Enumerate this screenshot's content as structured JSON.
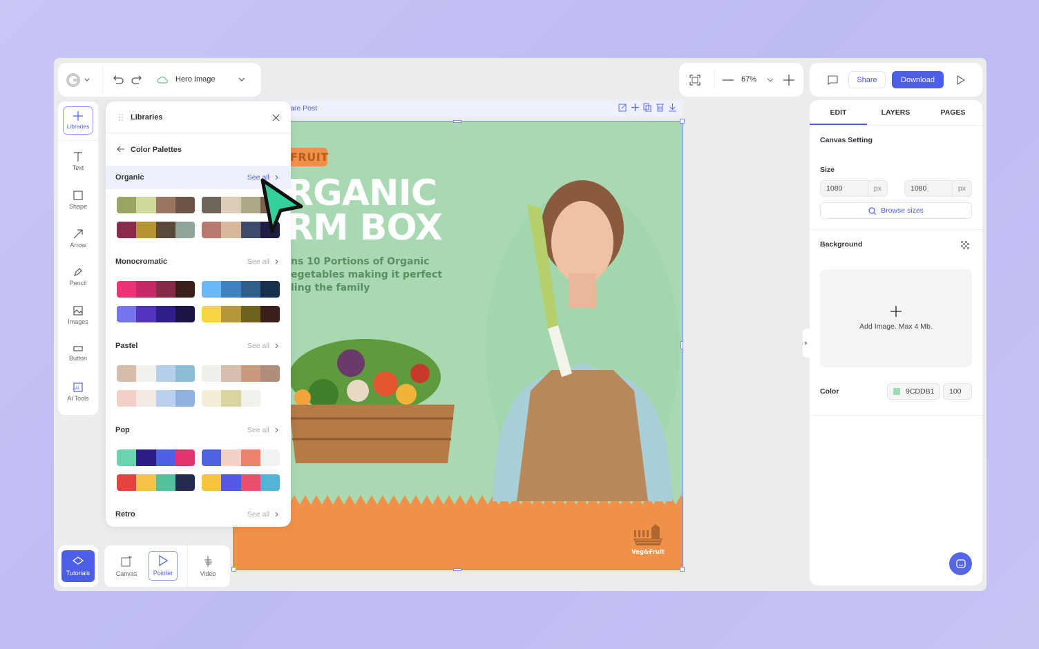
{
  "topbar": {
    "document_name": "Hero Image",
    "zoom": "67%",
    "share": "Share",
    "download": "Download"
  },
  "rail": [
    {
      "label": "Libraries",
      "icon": "plus-icon"
    },
    {
      "label": "Text",
      "icon": "text-icon"
    },
    {
      "label": "Shape",
      "icon": "square-icon"
    },
    {
      "label": "Arrow",
      "icon": "arrow-icon"
    },
    {
      "label": "Pencil",
      "icon": "pencil-icon"
    },
    {
      "label": "Images",
      "icon": "image-icon"
    },
    {
      "label": "Button",
      "icon": "button-icon"
    },
    {
      "label": "Ai Tools",
      "icon": "ai-icon"
    }
  ],
  "libraries": {
    "title": "Libraries",
    "subtitle": "Color Palettes",
    "see_all": "See all",
    "sections": [
      {
        "name": "Organic",
        "palettes": [
          [
            "#9aa564",
            "#d1d99a",
            "#9a7662",
            "#6d5444"
          ],
          [
            "#6d6559",
            "#dbcdb6",
            "#aca987",
            "#7a604f"
          ],
          [
            "#8b2a4d",
            "#b59533",
            "#5b4a3a",
            "#8fa597"
          ],
          [
            "#b57a6d",
            "#d9b89a",
            "#3d4a6c",
            "#1d1d45"
          ]
        ]
      },
      {
        "name": "Monocromatic",
        "palettes": [
          [
            "#ec3377",
            "#c52a66",
            "#842b48",
            "#3a1f1b"
          ],
          [
            "#6bb8f8",
            "#3f83c1",
            "#2e5e8a",
            "#18314f"
          ],
          [
            "#7675ed",
            "#5433c2",
            "#2e1e88",
            "#1b1544"
          ],
          [
            "#f6d443",
            "#b5983b",
            "#6e6221",
            "#3a201b"
          ]
        ]
      },
      {
        "name": "Pastel",
        "palettes": [
          [
            "#d6bcab",
            "#f3f1ec",
            "#b6cfea",
            "#8bbdd6"
          ],
          [
            "#f1efea",
            "#d6bfae",
            "#c99a7c",
            "#b18e7b"
          ],
          [
            "#f4cfc8",
            "#f3ebe3",
            "#b9d0ee",
            "#8fb2e3"
          ],
          [
            "#f5eed7",
            "#d9d5a1",
            "#f2f0ea"
          ]
        ]
      },
      {
        "name": "Pop",
        "palettes": [
          [
            "#6cd3b1",
            "#2e1d86",
            "#4d5fe3",
            "#e5336e"
          ],
          [
            "#4e62e3",
            "#f4d1c6",
            "#ef806c",
            "#f2f2f0"
          ],
          [
            "#e5433e",
            "#f6c34a",
            "#54c19e",
            "#252a53"
          ],
          [
            "#f6c43d",
            "#5259e0",
            "#e8506e",
            "#53b4d7"
          ]
        ]
      },
      {
        "name": "Retro",
        "palettes": []
      }
    ]
  },
  "canvas": {
    "header_title": "are Post",
    "badge": "FRUIT",
    "headline_1": "RGANIC",
    "headline_2": "RM BOX",
    "body_lines": [
      "ns 10 Portions of Organic",
      "egetables making it perfect",
      "ling the family"
    ],
    "logo_text": "Veg&Fruit",
    "bg_color": "#a8d9b2",
    "footer_color": "#f0914a"
  },
  "bottom": {
    "tutorials": "Tutorials",
    "tools": [
      {
        "label": "Canvas"
      },
      {
        "label": "Pointer",
        "active": true
      },
      {
        "label": "Video"
      }
    ]
  },
  "panel": {
    "tabs": [
      "EDIT",
      "LAYERS",
      "PAGES"
    ],
    "active_tab": "EDIT",
    "canvas_setting": "Canvas Setting",
    "size_label": "Size",
    "width": "1080",
    "height": "1080",
    "unit": "px",
    "browse_sizes": "Browse sizes",
    "background_label": "Background",
    "add_image": "Add Image. Max 4 Mb.",
    "color_label": "Color",
    "color_hex": "9CDDB1",
    "opacity": "100",
    "swatch": "#9cddb1"
  },
  "accent": "#4c5ee6"
}
